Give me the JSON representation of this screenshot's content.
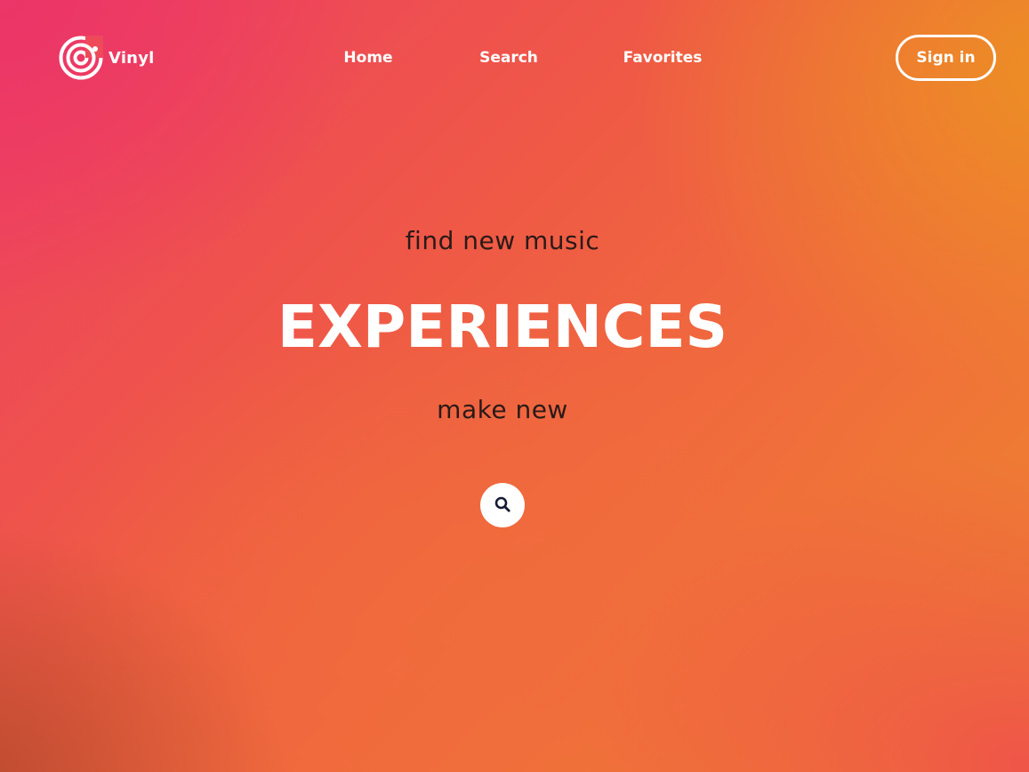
{
  "brand": {
    "name": "Vinyl",
    "logo_icon": "vinyl-record-icon"
  },
  "nav": {
    "items": [
      {
        "label": "Home"
      },
      {
        "label": "Search"
      },
      {
        "label": "Favorites"
      }
    ],
    "signin_label": "Sign in"
  },
  "hero": {
    "line1": "find new music",
    "headline": "EXPERIENCES",
    "line3": "make new",
    "search_icon": "search-icon"
  },
  "colors": {
    "gradient_top_left": "#ee3f62",
    "gradient_center": "#ef5a45",
    "gradient_top_right": "#ec8a2a",
    "text_dark": "#2a1a18",
    "text_light": "#ffffff",
    "search_icon_color": "#141a33"
  }
}
